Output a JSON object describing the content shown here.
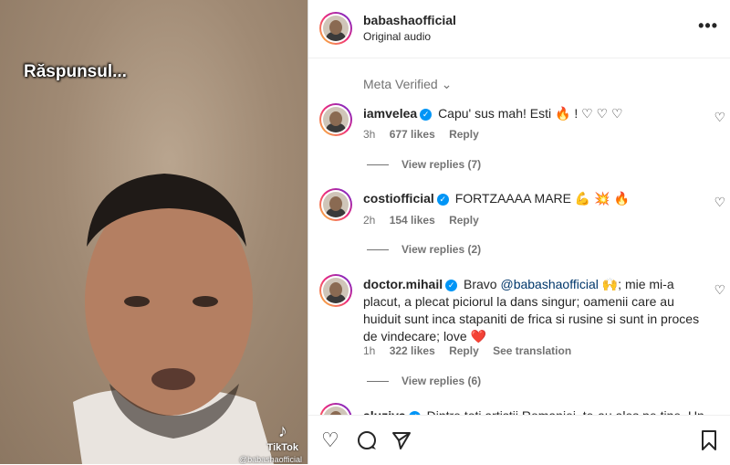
{
  "video": {
    "caption": "Răspunsul...",
    "watermark_logo": "TikTok",
    "watermark_handle": "@babashaofficial"
  },
  "post": {
    "username": "babashaofficial",
    "audio": "Original audio",
    "more_icon": "•••"
  },
  "meta_verified": "Meta Verified ⌄",
  "comments": [
    {
      "user": "iamvelea",
      "text": "Capu' sus mah! Esti 🔥 ! ♡ ♡ ♡",
      "time": "3h",
      "likes": "677 likes",
      "reply": "Reply",
      "view_replies": "View replies (7)"
    },
    {
      "user": "costiofficial",
      "text": "FORTZAAAA MARE 💪 💥 🔥",
      "time": "2h",
      "likes": "154 likes",
      "reply": "Reply",
      "view_replies": "View replies (2)"
    },
    {
      "user": "doctor.mihail",
      "text_before": "Bravo ",
      "mention": "@babashaofficial",
      "text_after": " 🙌; mie mi-a placut, a plecat piciorul la dans singur; oamenii care au huiduit sunt inca stapaniti de frica si rusine si sunt in proces de vindecare; love ❤️",
      "time": "1h",
      "likes": "322 likes",
      "reply": "Reply",
      "see_translation": "See translation",
      "view_replies": "View replies (6)"
    },
    {
      "user": "aluziva",
      "text": "Dintre toti artistii Romaniei, te-au ales pe tine. Un"
    }
  ],
  "icons": {
    "like": "♡",
    "comment": "💬",
    "share": "➤",
    "save": "🔖"
  }
}
